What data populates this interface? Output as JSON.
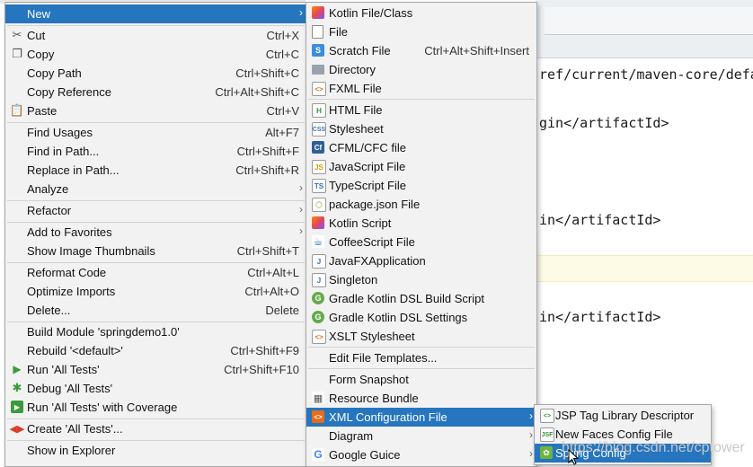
{
  "editor": {
    "code_lines": [
      "ref/current/maven-core/defa",
      "gin</artifactId>",
      "in</artifactId>",
      "in</artifactId>"
    ]
  },
  "context_menu": {
    "items": [
      {
        "label": "New",
        "shortcut": "",
        "submenu": true,
        "icon": "none",
        "selected": true
      },
      {
        "label": "Cut",
        "shortcut": "Ctrl+X",
        "icon": "scissors-icon"
      },
      {
        "label": "Copy",
        "shortcut": "Ctrl+C",
        "icon": "copy-icon"
      },
      {
        "label": "Copy Path",
        "shortcut": "Ctrl+Shift+C",
        "icon": "none"
      },
      {
        "label": "Copy Reference",
        "shortcut": "Ctrl+Alt+Shift+C",
        "icon": "none"
      },
      {
        "label": "Paste",
        "shortcut": "Ctrl+V",
        "icon": "paste-icon"
      },
      {
        "label": "Find Usages",
        "shortcut": "Alt+F7",
        "icon": "none"
      },
      {
        "label": "Find in Path...",
        "shortcut": "Ctrl+Shift+F",
        "icon": "none"
      },
      {
        "label": "Replace in Path...",
        "shortcut": "Ctrl+Shift+R",
        "icon": "none"
      },
      {
        "label": "Analyze",
        "shortcut": "",
        "submenu": true,
        "icon": "none"
      },
      {
        "label": "Refactor",
        "shortcut": "",
        "submenu": true,
        "icon": "none"
      },
      {
        "label": "Add to Favorites",
        "shortcut": "",
        "submenu": true,
        "icon": "none"
      },
      {
        "label": "Show Image Thumbnails",
        "shortcut": "Ctrl+Shift+T",
        "icon": "none"
      },
      {
        "label": "Reformat Code",
        "shortcut": "Ctrl+Alt+L",
        "icon": "none"
      },
      {
        "label": "Optimize Imports",
        "shortcut": "Ctrl+Alt+O",
        "icon": "none"
      },
      {
        "label": "Delete...",
        "shortcut": "Delete",
        "icon": "none"
      },
      {
        "label": "Build Module 'springdemo1.0'",
        "shortcut": "",
        "icon": "none"
      },
      {
        "label": "Rebuild '<default>'",
        "shortcut": "Ctrl+Shift+F9",
        "icon": "none"
      },
      {
        "label": "Run 'All Tests'",
        "shortcut": "Ctrl+Shift+F10",
        "icon": "run-icon"
      },
      {
        "label": "Debug 'All Tests'",
        "shortcut": "",
        "icon": "debug-icon"
      },
      {
        "label": "Run 'All Tests' with Coverage",
        "shortcut": "",
        "icon": "coverage-icon"
      },
      {
        "label": "Create 'All Tests'...",
        "shortcut": "",
        "icon": "create-test-icon"
      },
      {
        "label": "Show in Explorer",
        "shortcut": "",
        "icon": "none"
      }
    ]
  },
  "new_menu": {
    "items": [
      {
        "label": "Kotlin File/Class",
        "shortcut": "",
        "icon": "kotlin-icon"
      },
      {
        "label": "File",
        "shortcut": "",
        "icon": "file-icon"
      },
      {
        "label": "Scratch File",
        "shortcut": "Ctrl+Alt+Shift+Insert",
        "icon": "scratch-file-icon"
      },
      {
        "label": "Directory",
        "shortcut": "",
        "icon": "folder-icon"
      },
      {
        "label": "FXML File",
        "shortcut": "",
        "icon": "fxml-file-icon"
      },
      {
        "label": "HTML File",
        "shortcut": "",
        "icon": "html-file-icon"
      },
      {
        "label": "Stylesheet",
        "shortcut": "",
        "icon": "css-file-icon"
      },
      {
        "label": "CFML/CFC file",
        "shortcut": "",
        "icon": "cfml-file-icon"
      },
      {
        "label": "JavaScript File",
        "shortcut": "",
        "icon": "javascript-file-icon"
      },
      {
        "label": "TypeScript File",
        "shortcut": "",
        "icon": "typescript-file-icon"
      },
      {
        "label": "package.json File",
        "shortcut": "",
        "icon": "package-json-icon"
      },
      {
        "label": "Kotlin Script",
        "shortcut": "",
        "icon": "kotlin-script-icon"
      },
      {
        "label": "CoffeeScript File",
        "shortcut": "",
        "icon": "coffeescript-icon"
      },
      {
        "label": "JavaFXApplication",
        "shortcut": "",
        "icon": "javafx-icon"
      },
      {
        "label": "Singleton",
        "shortcut": "",
        "icon": "singleton-icon"
      },
      {
        "label": "Gradle Kotlin DSL Build Script",
        "shortcut": "",
        "icon": "gradle-icon"
      },
      {
        "label": "Gradle Kotlin DSL Settings",
        "shortcut": "",
        "icon": "gradle-icon"
      },
      {
        "label": "XSLT Stylesheet",
        "shortcut": "",
        "icon": "xslt-icon"
      },
      {
        "label": "Edit File Templates...",
        "shortcut": "",
        "icon": "none"
      },
      {
        "label": "Form Snapshot",
        "shortcut": "",
        "icon": "none"
      },
      {
        "label": "Resource Bundle",
        "shortcut": "",
        "icon": "resource-bundle-icon"
      },
      {
        "label": "XML Configuration File",
        "shortcut": "",
        "submenu": true,
        "icon": "xml-file-icon",
        "selected": true
      },
      {
        "label": "Diagram",
        "shortcut": "",
        "submenu": true,
        "icon": "none"
      },
      {
        "label": "Google Guice",
        "shortcut": "",
        "submenu": true,
        "icon": "google-icon"
      }
    ]
  },
  "xml_menu": {
    "items": [
      {
        "label": "JSP Tag Library Descriptor",
        "icon": "jsp-icon"
      },
      {
        "label": "New Faces Config File",
        "icon": "jsf-icon"
      },
      {
        "label": "Spring Config",
        "icon": "spring-icon",
        "selected": true
      }
    ]
  },
  "watermark": "https://blog.csdn.net/cptower",
  "colors": {
    "menu_bg": "#f2f2f2",
    "selection": "#2675bf",
    "separator": "#d2d2d2"
  }
}
